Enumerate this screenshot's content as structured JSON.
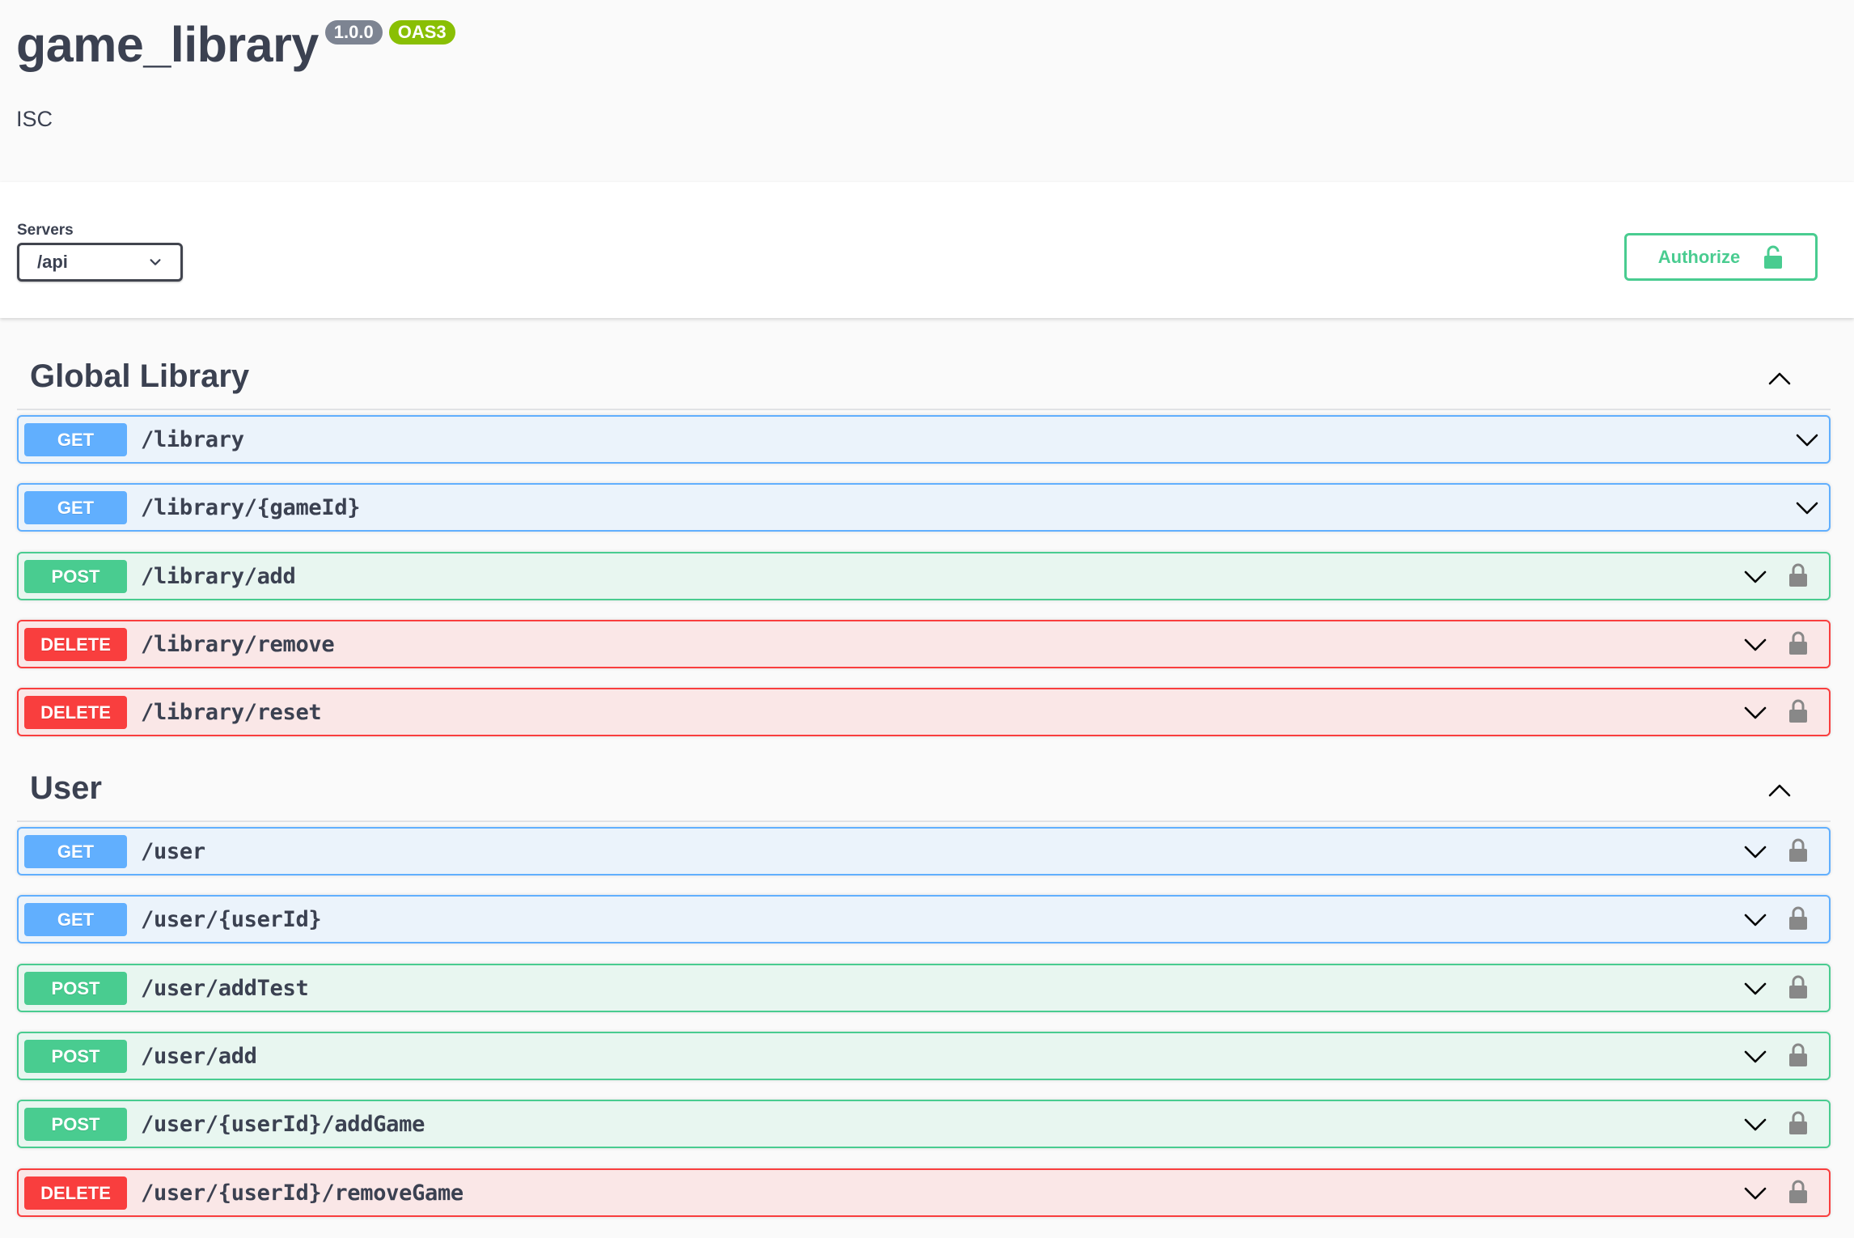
{
  "info": {
    "title": "game_library",
    "version": "1.0.0",
    "oas_badge": "OAS3",
    "license": "ISC"
  },
  "servers": {
    "label": "Servers",
    "selected": "/api"
  },
  "authorize": {
    "label": "Authorize"
  },
  "tags": [
    {
      "name": "Global Library",
      "operations": [
        {
          "method": "GET",
          "path": "/library",
          "locked": false
        },
        {
          "method": "GET",
          "path": "/library/{gameId}",
          "locked": false
        },
        {
          "method": "POST",
          "path": "/library/add",
          "locked": true
        },
        {
          "method": "DELETE",
          "path": "/library/remove",
          "locked": true
        },
        {
          "method": "DELETE",
          "path": "/library/reset",
          "locked": true
        }
      ]
    },
    {
      "name": "User",
      "operations": [
        {
          "method": "GET",
          "path": "/user",
          "locked": true
        },
        {
          "method": "GET",
          "path": "/user/{userId}",
          "locked": true
        },
        {
          "method": "POST",
          "path": "/user/addTest",
          "locked": true
        },
        {
          "method": "POST",
          "path": "/user/add",
          "locked": true
        },
        {
          "method": "POST",
          "path": "/user/{userId}/addGame",
          "locked": true
        },
        {
          "method": "DELETE",
          "path": "/user/{userId}/removeGame",
          "locked": true
        }
      ]
    }
  ],
  "colors": {
    "get": "#61affe",
    "post": "#49cc90",
    "delete": "#f93e3e",
    "authorize": "#49cc90",
    "oas_badge": "#89bf04",
    "version_badge": "#7d8492"
  },
  "icons": {
    "servers_dropdown": "chevron-down-icon",
    "authorize": "lock-icon",
    "tag_toggle": "chevron-up-icon",
    "operation_expand": "chevron-down-icon",
    "operation_auth": "lock-icon"
  }
}
